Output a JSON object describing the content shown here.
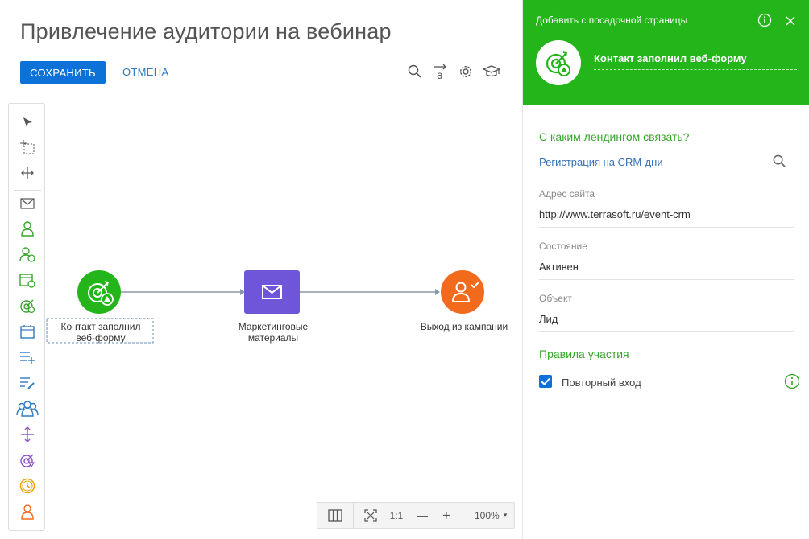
{
  "page": {
    "title": "Привлечение аудитории на вебинар",
    "save_label": "СОХРАНИТЬ",
    "cancel_label": "ОТМЕНА"
  },
  "toolbar": {
    "icons": [
      "search-icon",
      "text-label-icon",
      "gear-icon",
      "graduation-cap-icon"
    ]
  },
  "palette": {
    "items": [
      "pointer-icon",
      "add-area-icon",
      "split-icon",
      "email-icon",
      "contact-icon",
      "contact-triggered-icon",
      "event-icon",
      "landing-target-icon",
      "calendar-icon",
      "add-list-icon",
      "edit-list-icon",
      "audience-icon",
      "connector-icon",
      "target-icon",
      "timer-icon",
      "exit-contact-icon"
    ]
  },
  "nodes": [
    {
      "label_line1": "Контакт заполнил",
      "label_line2": "веб-форму",
      "color": "#23b51a"
    },
    {
      "label_line1": "Маркетинговые",
      "label_line2": "материалы",
      "color": "#6f55d8"
    },
    {
      "label_line1": "Выход из кампании",
      "label_line2": "",
      "color": "#f26b1d"
    }
  ],
  "zoom": {
    "ratio_label": "1:1",
    "minus": "—",
    "plus": "+",
    "level": "100%",
    "caret": "▾"
  },
  "panel": {
    "header_title": "Добавить с посадочной страницы",
    "element_name": "Контакт заполнил веб-форму",
    "section_landing": "С каким лендингом связать?",
    "landing_value": "Регистрация на CRM-дни",
    "site_label": "Адрес сайта",
    "site_value": "http://www.terrasoft.ru/event-crm",
    "state_label": "Состояние",
    "state_value": "Активен",
    "object_label": "Объект",
    "object_value": "Лид",
    "section_rules": "Правила участия",
    "reentry_label": "Повторный вход",
    "reentry_checked": true
  },
  "colors": {
    "accent_blue": "#0c72d8",
    "header_green": "#23b51a",
    "section_green": "#36a52b"
  }
}
